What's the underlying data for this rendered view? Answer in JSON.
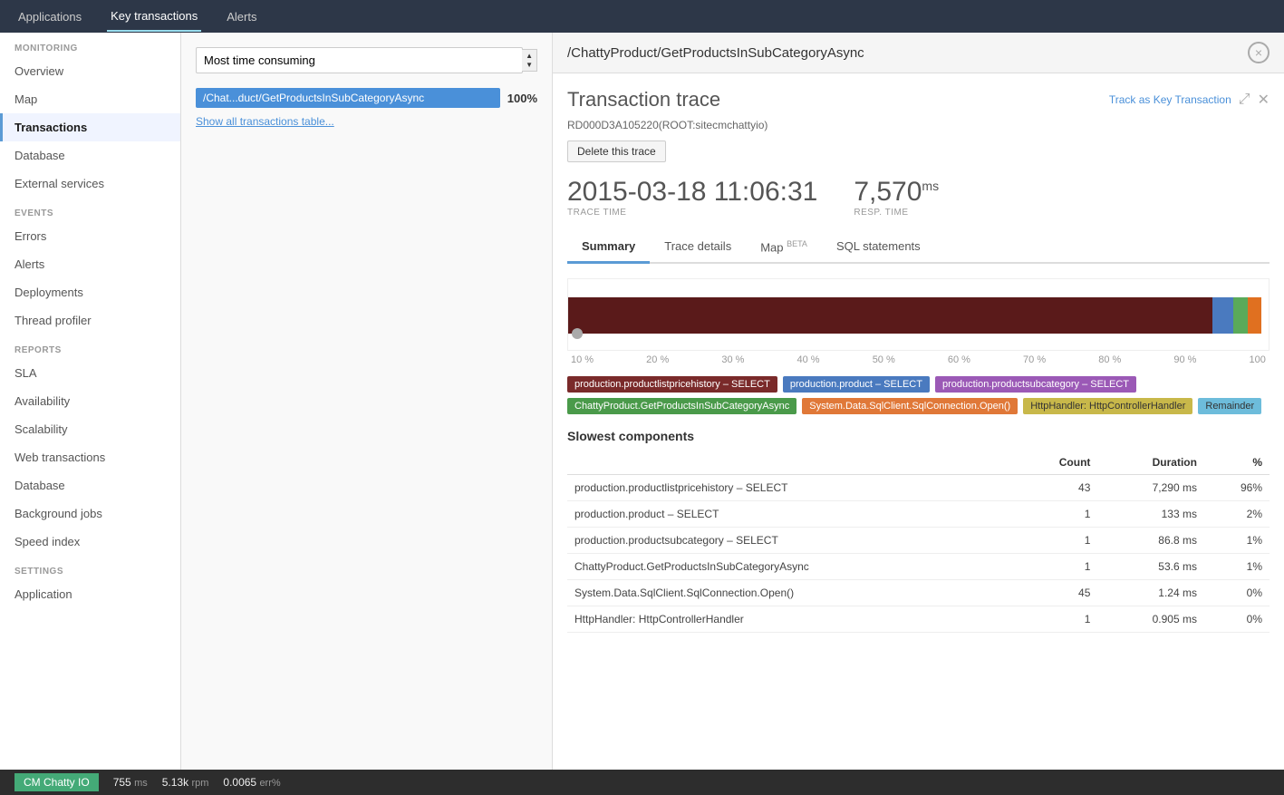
{
  "topnav": {
    "items": [
      {
        "label": "Applications",
        "active": false
      },
      {
        "label": "Key transactions",
        "active": true
      },
      {
        "label": "Alerts",
        "active": false
      }
    ]
  },
  "sidebar": {
    "monitoring_label": "MONITORING",
    "events_label": "EVENTS",
    "reports_label": "REPORTS",
    "settings_label": "SETTINGS",
    "monitoring_items": [
      {
        "label": "Overview",
        "active": false
      },
      {
        "label": "Map",
        "active": false
      },
      {
        "label": "Transactions",
        "active": true
      },
      {
        "label": "Database",
        "active": false
      },
      {
        "label": "External services",
        "active": false
      }
    ],
    "events_items": [
      {
        "label": "Errors",
        "active": false
      },
      {
        "label": "Alerts",
        "active": false
      },
      {
        "label": "Deployments",
        "active": false
      },
      {
        "label": "Thread profiler",
        "active": false
      }
    ],
    "reports_items": [
      {
        "label": "SLA",
        "active": false
      },
      {
        "label": "Availability",
        "active": false
      },
      {
        "label": "Scalability",
        "active": false
      },
      {
        "label": "Web transactions",
        "active": false
      },
      {
        "label": "Database",
        "active": false
      },
      {
        "label": "Background jobs",
        "active": false
      },
      {
        "label": "Speed index",
        "active": false
      }
    ],
    "settings_items": [
      {
        "label": "Application",
        "active": false
      }
    ]
  },
  "tx_panel": {
    "filter_label": "Most time consuming",
    "transaction": {
      "label": "/Chat...duct/GetProductsInSubCategoryAsync",
      "pct": "100%"
    },
    "show_all_link": "Show all transactions table..."
  },
  "trace_header": {
    "title": "/ChattyProduct/GetProductsInSubCategoryAsync",
    "close_icon": "×"
  },
  "trace": {
    "title": "Transaction trace",
    "id": "RD000D3A105220(ROOT:sitecmchattyio)",
    "delete_btn": "Delete this trace",
    "track_key_btn": "Track as Key Transaction",
    "metrics": {
      "trace_time_val": "2015-03-18 11:06:31",
      "trace_time_label": "TRACE TIME",
      "resp_time_val": "7,570",
      "resp_time_unit": "ms",
      "resp_time_label": "RESP. TIME"
    },
    "tabs": [
      {
        "label": "Summary",
        "active": true
      },
      {
        "label": "Trace details",
        "active": false
      },
      {
        "label": "Map",
        "super": "BETA",
        "active": false
      },
      {
        "label": "SQL statements",
        "active": false
      }
    ],
    "legend": [
      {
        "label": "production.productlistpricehistory – SELECT",
        "color": "#7a2a2a"
      },
      {
        "label": "production.product – SELECT",
        "color": "#4a7abf"
      },
      {
        "label": "production.productsubcategory – SELECT",
        "color": "#9b59b6"
      },
      {
        "label": "ChattyProduct.GetProductsInSubCategoryAsync",
        "color": "#4a9a4a"
      },
      {
        "label": "System.Data.SqlClient.SqlConnection.Open()",
        "color": "#e07838"
      },
      {
        "label": "HttpHandler: HttpControllerHandler",
        "color": "#c8b84a"
      },
      {
        "label": "Remainder",
        "color": "#6dbcdb"
      }
    ],
    "chart": {
      "labels": [
        "10 %",
        "20 %",
        "30 %",
        "40 %",
        "50 %",
        "60 %",
        "70 %",
        "80 %",
        "90 %",
        "100"
      ]
    },
    "slowest_components": {
      "title": "Slowest components",
      "columns": [
        "",
        "Count",
        "Duration",
        "%"
      ],
      "rows": [
        {
          "name": "production.productlistpricehistory – SELECT",
          "count": "43",
          "duration": "7,290 ms",
          "pct": "96%"
        },
        {
          "name": "production.product – SELECT",
          "count": "1",
          "duration": "133 ms",
          "pct": "2%"
        },
        {
          "name": "production.productsubcategory – SELECT",
          "count": "1",
          "duration": "86.8 ms",
          "pct": "1%"
        },
        {
          "name": "ChattyProduct.GetProductsInSubCategoryAsync",
          "count": "1",
          "duration": "53.6 ms",
          "pct": "1%"
        },
        {
          "name": "System.Data.SqlClient.SqlConnection.Open()",
          "count": "45",
          "duration": "1.24 ms",
          "pct": "0%"
        },
        {
          "name": "HttpHandler: HttpControllerHandler",
          "count": "1",
          "duration": "0.905 ms",
          "pct": "0%"
        }
      ]
    }
  },
  "statusbar": {
    "app_name": "CM Chatty IO",
    "metric1_val": "755",
    "metric1_unit": "ms",
    "metric2_val": "5.13k",
    "metric2_unit": "rpm",
    "metric3_val": "0.0065",
    "metric3_unit": "err%"
  }
}
